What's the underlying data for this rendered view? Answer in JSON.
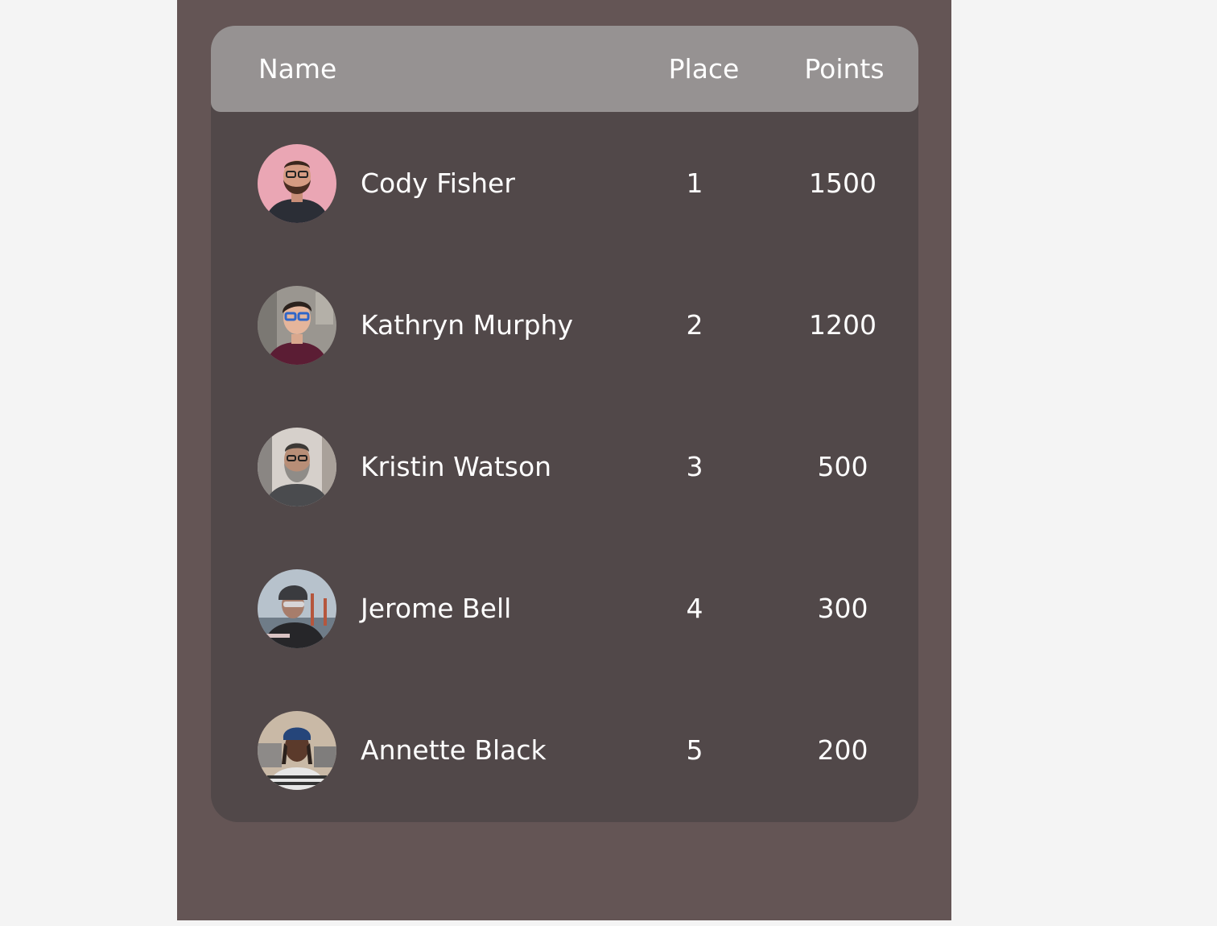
{
  "leaderboard": {
    "columns": {
      "name": "Name",
      "place": "Place",
      "points": "Points"
    },
    "rows": [
      {
        "name": "Cody Fisher",
        "place": "1",
        "points": "1500"
      },
      {
        "name": "Kathryn Murphy",
        "place": "2",
        "points": "1200"
      },
      {
        "name": "Kristin Watson",
        "place": "3",
        "points": "500"
      },
      {
        "name": "Jerome Bell",
        "place": "4",
        "points": "300"
      },
      {
        "name": "Annette Black",
        "place": "5",
        "points": "200"
      }
    ]
  },
  "colors": {
    "page_background": "#f4f4f4",
    "panel_background": "#645555",
    "table_background": "#514849",
    "header_background": "#969292",
    "text": "#ffffff"
  }
}
